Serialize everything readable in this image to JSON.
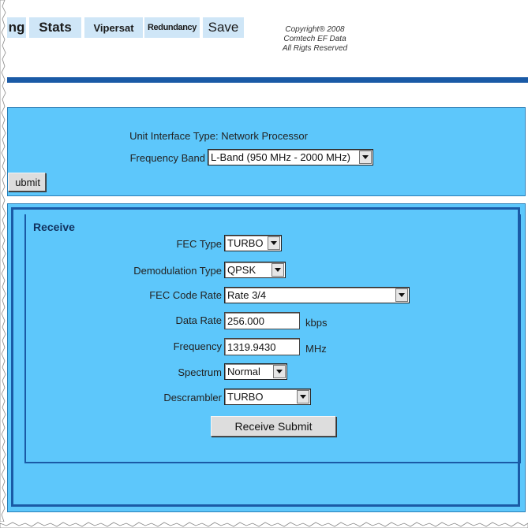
{
  "nav": {
    "tabs": [
      {
        "label": "ng"
      },
      {
        "label": "Stats"
      },
      {
        "label": "Vipersat"
      },
      {
        "label": "Redundancy"
      },
      {
        "label": "Save"
      }
    ],
    "copyright": [
      "Copyright® 2008",
      "Comtech EF Data",
      "All Rigts Reserved"
    ]
  },
  "unit": {
    "interface_type_label": "Unit Interface Type:",
    "interface_type_value": "Network Processor",
    "frequency_band_label": "Frequency Band",
    "frequency_band_value": "L-Band (950 MHz - 2000 MHz)",
    "submit_label": "ubmit"
  },
  "receive": {
    "title": "Receive",
    "fec_type": {
      "label": "FEC Type",
      "value": "TURBO"
    },
    "demod_type": {
      "label": "Demodulation Type",
      "value": "QPSK"
    },
    "fec_code_rate": {
      "label": "FEC Code Rate",
      "value": "Rate 3/4"
    },
    "data_rate": {
      "label": "Data Rate",
      "value": "256.000",
      "unit": "kbps"
    },
    "frequency": {
      "label": "Frequency",
      "value": "1319.9430",
      "unit": "MHz"
    },
    "spectrum": {
      "label": "Spectrum",
      "value": "Normal"
    },
    "descrambler": {
      "label": "Descrambler",
      "value": "TURBO"
    },
    "submit_label": "Receive Submit"
  },
  "colors": {
    "panel": "#5dc7fb",
    "rule": "#1a5aa6",
    "tab": "#cfe6f7"
  }
}
